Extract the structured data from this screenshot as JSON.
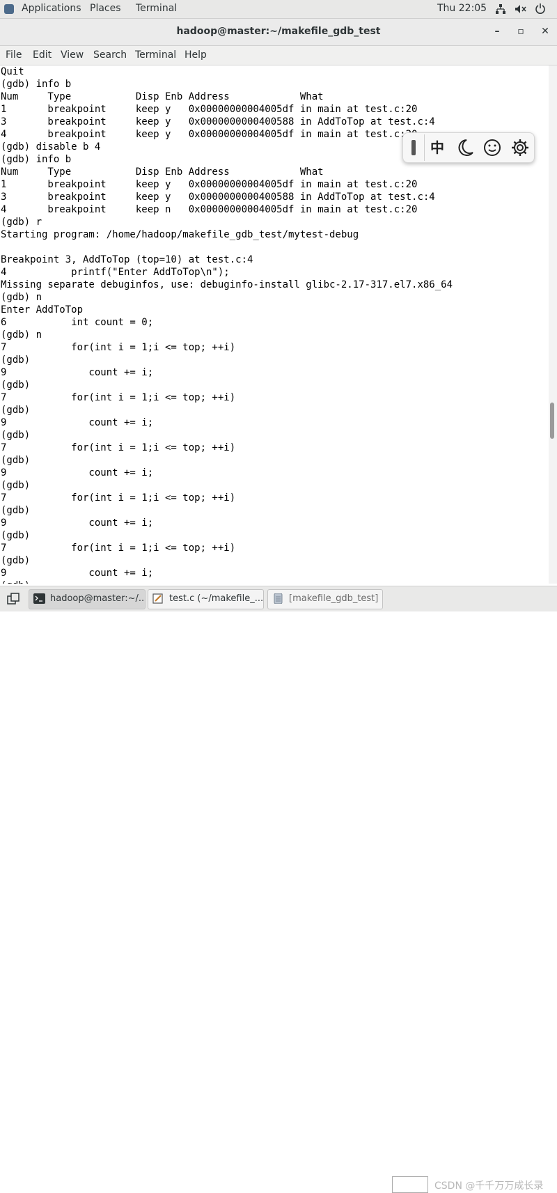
{
  "topbar": {
    "applications": "Applications",
    "places": "Places",
    "terminal": "Terminal",
    "clock": "Thu 22:05",
    "tray_icons": [
      "network-icon",
      "volume-icon",
      "power-icon"
    ]
  },
  "window": {
    "title": "hadoop@master:~/makefile_gdb_test",
    "minimize": "–",
    "maximize": "▫",
    "close": "✕"
  },
  "menubar": {
    "items": [
      "File",
      "Edit",
      "View",
      "Search",
      "Terminal",
      "Help"
    ]
  },
  "terminal": {
    "lines": [
      "Quit",
      "(gdb) info b",
      "Num     Type           Disp Enb Address            What",
      "1       breakpoint     keep y   0x00000000004005df in main at test.c:20",
      "3       breakpoint     keep y   0x0000000000400588 in AddToTop at test.c:4",
      "4       breakpoint     keep y   0x00000000004005df in main at test.c:20",
      "(gdb) disable b 4",
      "(gdb) info b",
      "Num     Type           Disp Enb Address            What",
      "1       breakpoint     keep y   0x00000000004005df in main at test.c:20",
      "3       breakpoint     keep y   0x0000000000400588 in AddToTop at test.c:4",
      "4       breakpoint     keep n   0x00000000004005df in main at test.c:20",
      "(gdb) r",
      "Starting program: /home/hadoop/makefile_gdb_test/mytest-debug",
      "",
      "Breakpoint 3, AddToTop (top=10) at test.c:4",
      "4           printf(\"Enter AddToTop\\n\");",
      "Missing separate debuginfos, use: debuginfo-install glibc-2.17-317.el7.x86_64",
      "(gdb) n",
      "Enter AddToTop",
      "6           int count = 0;",
      "(gdb) n",
      "7           for(int i = 1;i <= top; ++i)",
      "(gdb)",
      "9              count += i;",
      "(gdb)",
      "7           for(int i = 1;i <= top; ++i)",
      "(gdb)",
      "9              count += i;",
      "(gdb)",
      "7           for(int i = 1;i <= top; ++i)",
      "(gdb)",
      "9              count += i;",
      "(gdb)",
      "7           for(int i = 1;i <= top; ++i)",
      "(gdb)",
      "9              count += i;",
      "(gdb)",
      "7           for(int i = 1;i <= top; ++i)",
      "(gdb)",
      "9              count += i;",
      "(gdb)"
    ]
  },
  "ime_toolbar": {
    "chinese": "中",
    "items": [
      "moon-icon",
      "emoji-icon",
      "gear-icon"
    ]
  },
  "taskbar": {
    "tasks": [
      {
        "label": "hadoop@master:~/...",
        "icon": "terminal-icon",
        "active": true
      },
      {
        "label": "test.c (~/makefile_...",
        "icon": "editor-icon",
        "active": false
      },
      {
        "label": "[makefile_gdb_test]",
        "icon": "file-manager-icon",
        "active": false
      }
    ],
    "watermark": "CSDN @千千万万成长录"
  },
  "colors": {
    "panel_bg": "#e8e8e7",
    "terminal_bg": "#ffffff",
    "terminal_fg": "#000000"
  }
}
